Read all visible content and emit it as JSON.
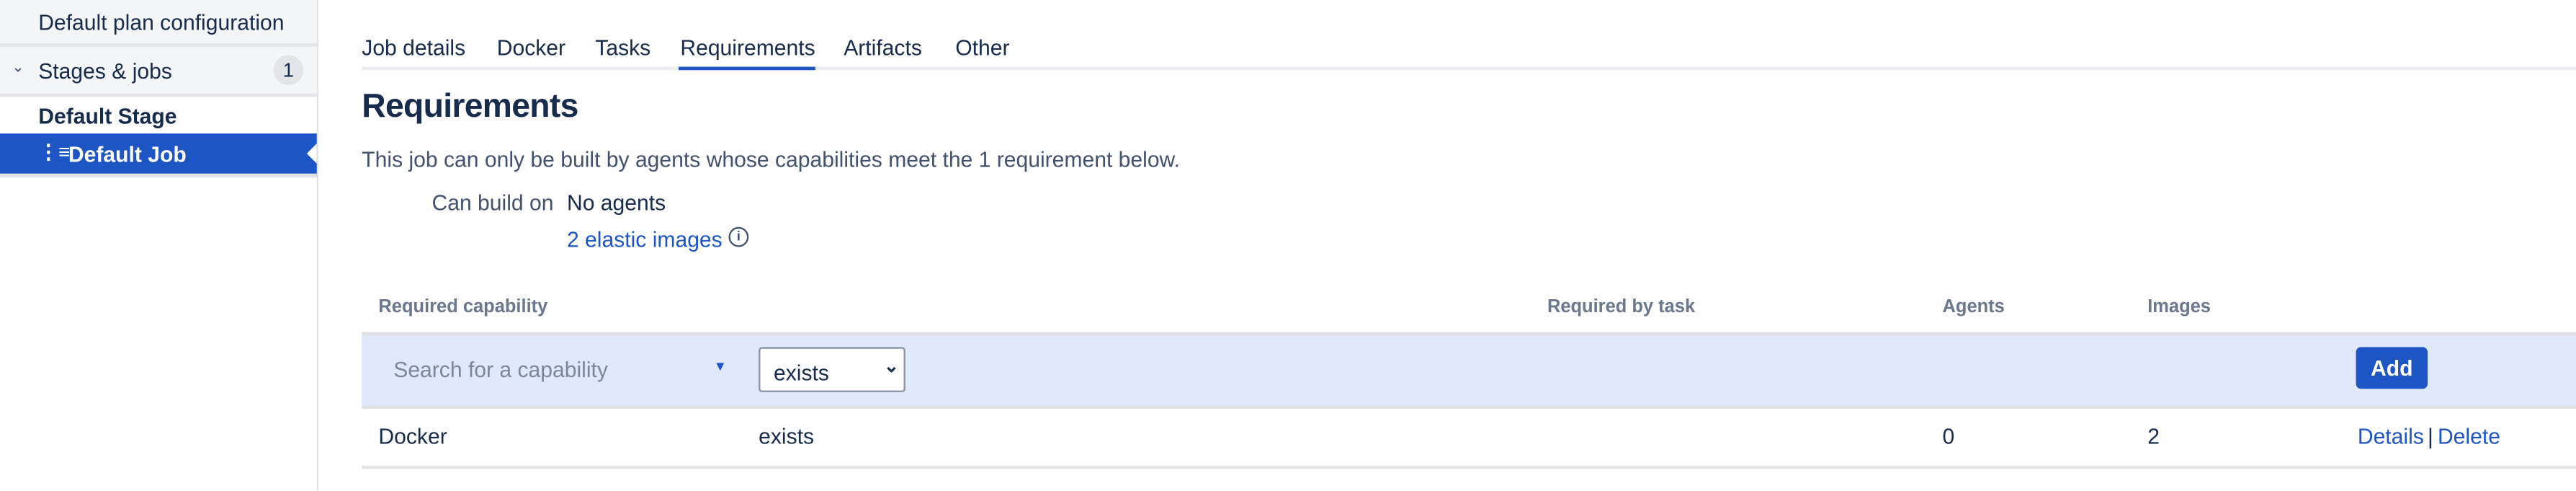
{
  "sidebar": {
    "plan_config": "Default plan configuration",
    "stages_jobs": {
      "label": "Stages & jobs",
      "count": "1"
    },
    "stage": "Default Stage",
    "job": "Default Job"
  },
  "tabs": [
    {
      "label": "Job details"
    },
    {
      "label": "Docker"
    },
    {
      "label": "Tasks"
    },
    {
      "label": "Requirements",
      "active": true
    },
    {
      "label": "Artifacts"
    },
    {
      "label": "Other"
    }
  ],
  "main": {
    "title": "Requirements",
    "description": "This job can only be built by agents whose capabilities meet the 1 requirement below.",
    "can_build_on_label": "Can build on",
    "can_build_on_value": "No agents",
    "elastic_images_link": "2 elastic images"
  },
  "table": {
    "headers": [
      "Required capability",
      "Required by task",
      "Agents",
      "Images"
    ],
    "add_row": {
      "search_placeholder": "Search for a capability",
      "condition_selected": "exists",
      "add_label": "Add"
    },
    "rows": [
      {
        "capability": "Docker",
        "condition": "exists",
        "task": "",
        "agents": "0",
        "images": "2",
        "details": "Details",
        "separator": "|",
        "delete": "Delete"
      }
    ]
  },
  "colors": {
    "accent": "#1d55c4",
    "add_row_bg": "#dfe9fb",
    "sidebar_bg": "#f4f5f7"
  }
}
